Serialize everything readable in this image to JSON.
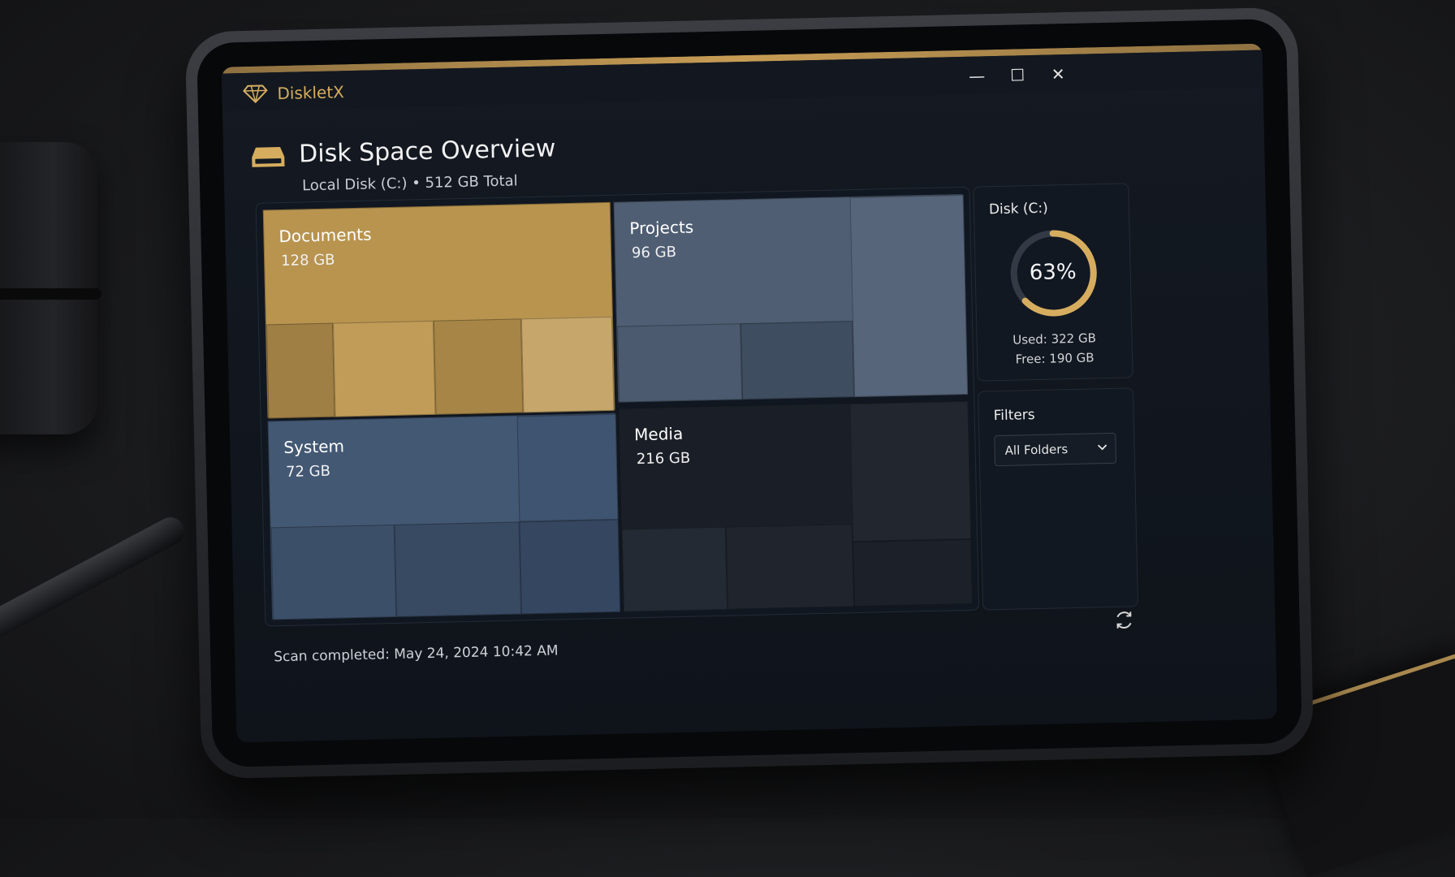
{
  "app": {
    "name": "DiskletX",
    "logo_icon": "diamond-icon",
    "accent": "#d6ad5f"
  },
  "window_controls": {
    "minimize": "—",
    "maximize": "☐",
    "close": "✕"
  },
  "header": {
    "title": "Disk Space Overview",
    "subtitle": "Local Disk (C:) • 512 GB Total",
    "icon": "drive-icon"
  },
  "treemap": {
    "folders": [
      {
        "label": "Documents",
        "size": "128 GB",
        "color": "#b8944f"
      },
      {
        "label": "Projects",
        "size": "96 GB",
        "color": "#4f5e73"
      },
      {
        "label": "System",
        "size": "72 GB",
        "color": "#435873"
      },
      {
        "label": "Media",
        "size": "216 GB",
        "color": "#1a1f27"
      }
    ]
  },
  "disk": {
    "title": "Disk (C:)",
    "percent_label": "63%",
    "percent_used": 0.63,
    "used": "Used: 322 GB",
    "free": "Free: 190 GB",
    "ring_color": "#d6ad5f",
    "track_color": "#333a45"
  },
  "filters": {
    "title": "Filters",
    "selected": "All Folders"
  },
  "footer": {
    "scan_status": "Scan completed: May 24, 2024 10:42 AM"
  }
}
